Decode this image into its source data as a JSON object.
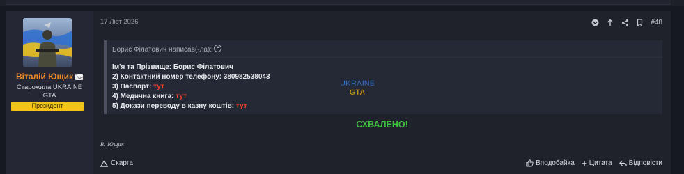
{
  "post": {
    "date": "17 Лют 2026",
    "number": "#48"
  },
  "user": {
    "name": "Віталій Ющик",
    "title": "Старожила UKRAINE GTA",
    "rank": "Президент"
  },
  "quote": {
    "author_line": "Борис Філатович написав(-ла):",
    "lines": [
      {
        "label": "Ім'я та Прізвище: Борис Філатович",
        "link": ""
      },
      {
        "label": "2) Контактний номер телефону: 380982538043",
        "link": ""
      },
      {
        "label": "3) Паспорт: ",
        "link": "тут"
      },
      {
        "label": "4) Медична книга: ",
        "link": "тут"
      },
      {
        "label": "5) Докази переводу в казну коштів: ",
        "link": "тут"
      }
    ]
  },
  "status": "СХВАЛЕНО!",
  "signature": "В. Ющик",
  "watermark": {
    "line1": "UKRAINE",
    "line2": "GTA"
  },
  "footer": {
    "report": "Скарга",
    "like": "Вподобайка",
    "quote": "Цитата",
    "reply": "Відповісти"
  },
  "colors": {
    "username": "#f28c28",
    "rank_bg": "#f2c418",
    "link": "#ff3b30",
    "approved": "#3fc23f"
  }
}
